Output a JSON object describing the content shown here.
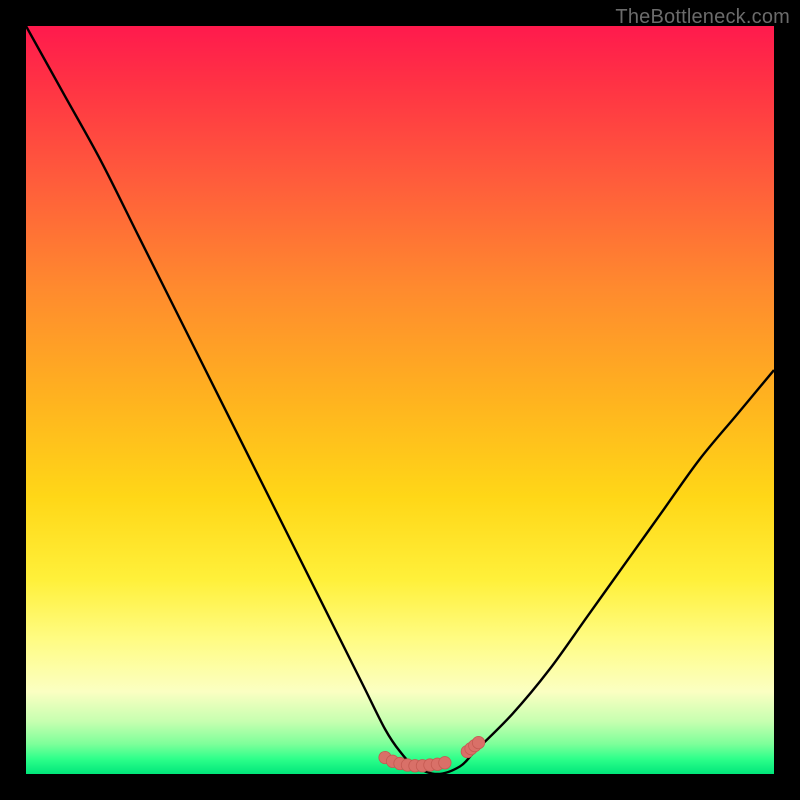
{
  "watermark": "TheBottleneck.com",
  "colors": {
    "curve_stroke": "#000000",
    "marker_fill": "#d97068",
    "marker_stroke": "#c55a52",
    "background_black": "#000000"
  },
  "chart_data": {
    "type": "line",
    "title": "",
    "xlabel": "",
    "ylabel": "",
    "xlim": [
      0,
      100
    ],
    "ylim": [
      0,
      100
    ],
    "x": [
      0,
      5,
      10,
      15,
      20,
      25,
      30,
      35,
      40,
      45,
      48,
      50,
      52,
      55,
      58,
      60,
      65,
      70,
      75,
      80,
      85,
      90,
      95,
      100
    ],
    "series": [
      {
        "name": "bottleneck-curve",
        "values": [
          100,
          91,
          82,
          72,
          62,
          52,
          42,
          32,
          22,
          12,
          6,
          3,
          1,
          0,
          1,
          3,
          8,
          14,
          21,
          28,
          35,
          42,
          48,
          54
        ]
      }
    ],
    "markers": {
      "name": "highlight-dots",
      "points_x": [
        48,
        49,
        50,
        51,
        52,
        53,
        54,
        55,
        56,
        59,
        59.5,
        60,
        60.5
      ],
      "points_y": [
        2.2,
        1.7,
        1.4,
        1.2,
        1.1,
        1.1,
        1.2,
        1.3,
        1.5,
        3.0,
        3.4,
        3.8,
        4.2
      ]
    }
  }
}
